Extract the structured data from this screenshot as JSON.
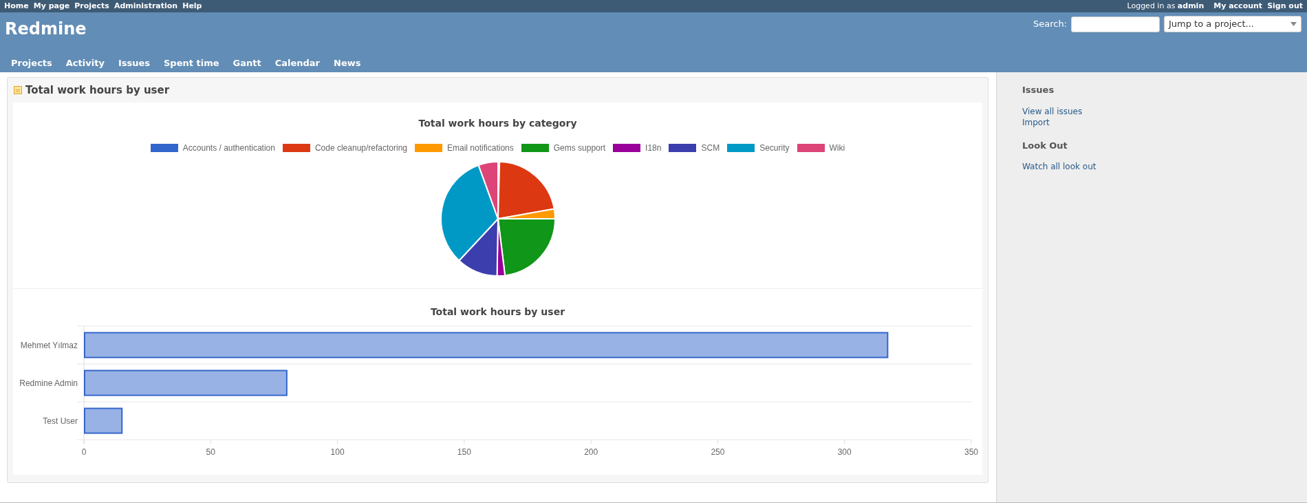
{
  "top_menu": {
    "links": [
      "Home",
      "My page",
      "Projects",
      "Administration",
      "Help"
    ],
    "logged_in_as": "Logged in as **admin**",
    "account_links": [
      "My account",
      "Sign out"
    ]
  },
  "header": {
    "title": "Redmine",
    "search_label": "Search:",
    "project_jump": {
      "value": "Jump to a project..."
    }
  },
  "main_menu": [
    {
      "label": "Projects",
      "selected": false
    },
    {
      "label": "Activity",
      "selected": false
    },
    {
      "label": "Issues",
      "selected": false
    },
    {
      "label": "Spent time",
      "selected": false
    },
    {
      "label": "Gantt",
      "selected": false
    },
    {
      "label": "Calendar",
      "selected": false
    },
    {
      "label": "News",
      "selected": false
    }
  ],
  "content": {
    "title": "Total work hours by user",
    "category_chart": {
      "title": "Total work hours by category",
      "legend": [
        {
          "label": "Accounts / authentication",
          "color": "#3366cc"
        },
        {
          "label": "Code cleanup/refactoring",
          "color": "#dc3912"
        },
        {
          "label": "Email notifications",
          "color": "#ff9900"
        },
        {
          "label": "Gems support",
          "color": "#109618"
        },
        {
          "label": "I18n",
          "color": "#990099"
        },
        {
          "label": "SCM",
          "color": "#3b3eac"
        },
        {
          "label": "Security",
          "color": "#0099c6"
        },
        {
          "label": "Wiki",
          "color": "#dd4477"
        }
      ]
    },
    "user_chart": {
      "chart_data": {
        "type": "bar",
        "orientation": "horizontal",
        "title": "Total work hours by user",
        "categories": [
          "Mehmet Yılmaz",
          "Redmine Admin",
          "Test User"
        ],
        "series": [
          {
            "color": "#3366cc",
            "values": [
              317,
              80,
              15
            ]
          }
        ],
        "xlim": [
          0,
          350
        ],
        "xticks": [
          0,
          50,
          100,
          150,
          200,
          250,
          300,
          350
        ]
      }
    }
  },
  "sidebar": {
    "sections": [
      {
        "heading": "Issues",
        "links": [
          "View all issues",
          "Import"
        ]
      },
      {
        "heading": "Look Out",
        "links": [
          "Watch all look out"
        ]
      }
    ]
  }
}
